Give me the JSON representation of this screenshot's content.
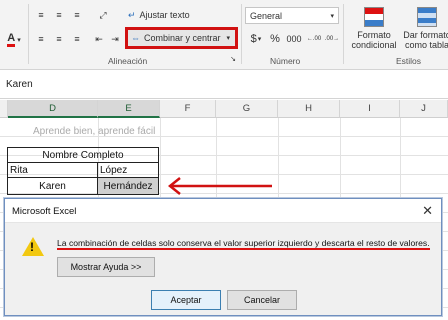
{
  "ribbon": {
    "font_group_label": "",
    "alignment_group_label": "Alineación",
    "number_group_label": "Número",
    "styles_group_label": "Estilos",
    "wrap_text_label": "Ajustar texto",
    "merge_center_label": "Combinar y centrar",
    "merge_dropdown": "▾",
    "number_format_value": "General",
    "number_format_dropdown": "▾",
    "currency_symbol": "$",
    "currency_dropdown": "▾",
    "percent_symbol": "%",
    "thousands_symbol": "000",
    "increase_decimal": "←.00",
    "decrease_decimal": ".00→",
    "conditional_format_label_1": "Formato",
    "conditional_format_label_2": "condicional",
    "format_table_label_1": "Dar formato",
    "format_table_label_2": "como tabla",
    "font_color_letter": "A",
    "font_color_dropdown": "▾"
  },
  "formula_bar": {
    "value": "Karen"
  },
  "columns": [
    "D",
    "E",
    "F",
    "G",
    "H",
    "I",
    "J"
  ],
  "sheet": {
    "subtitle": "Aprende bien, aprende fácil",
    "header": "Nombre Completo",
    "cells": {
      "d1": "Rita",
      "e1": "López",
      "d2": "Karen",
      "e2": "Hernández"
    }
  },
  "dialog": {
    "title": "Microsoft Excel",
    "close": "✕",
    "message": "La combinación de celdas solo conserva el valor superior izquierdo y descarta el resto de valores.",
    "help_button": "Mostrar Ayuda >>",
    "ok_button": "Aceptar",
    "cancel_button": "Cancelar",
    "warning_glyph": "!"
  },
  "colors": {
    "highlight_red": "#d11111",
    "excel_green": "#217346",
    "warning_yellow": "#f2c811"
  }
}
